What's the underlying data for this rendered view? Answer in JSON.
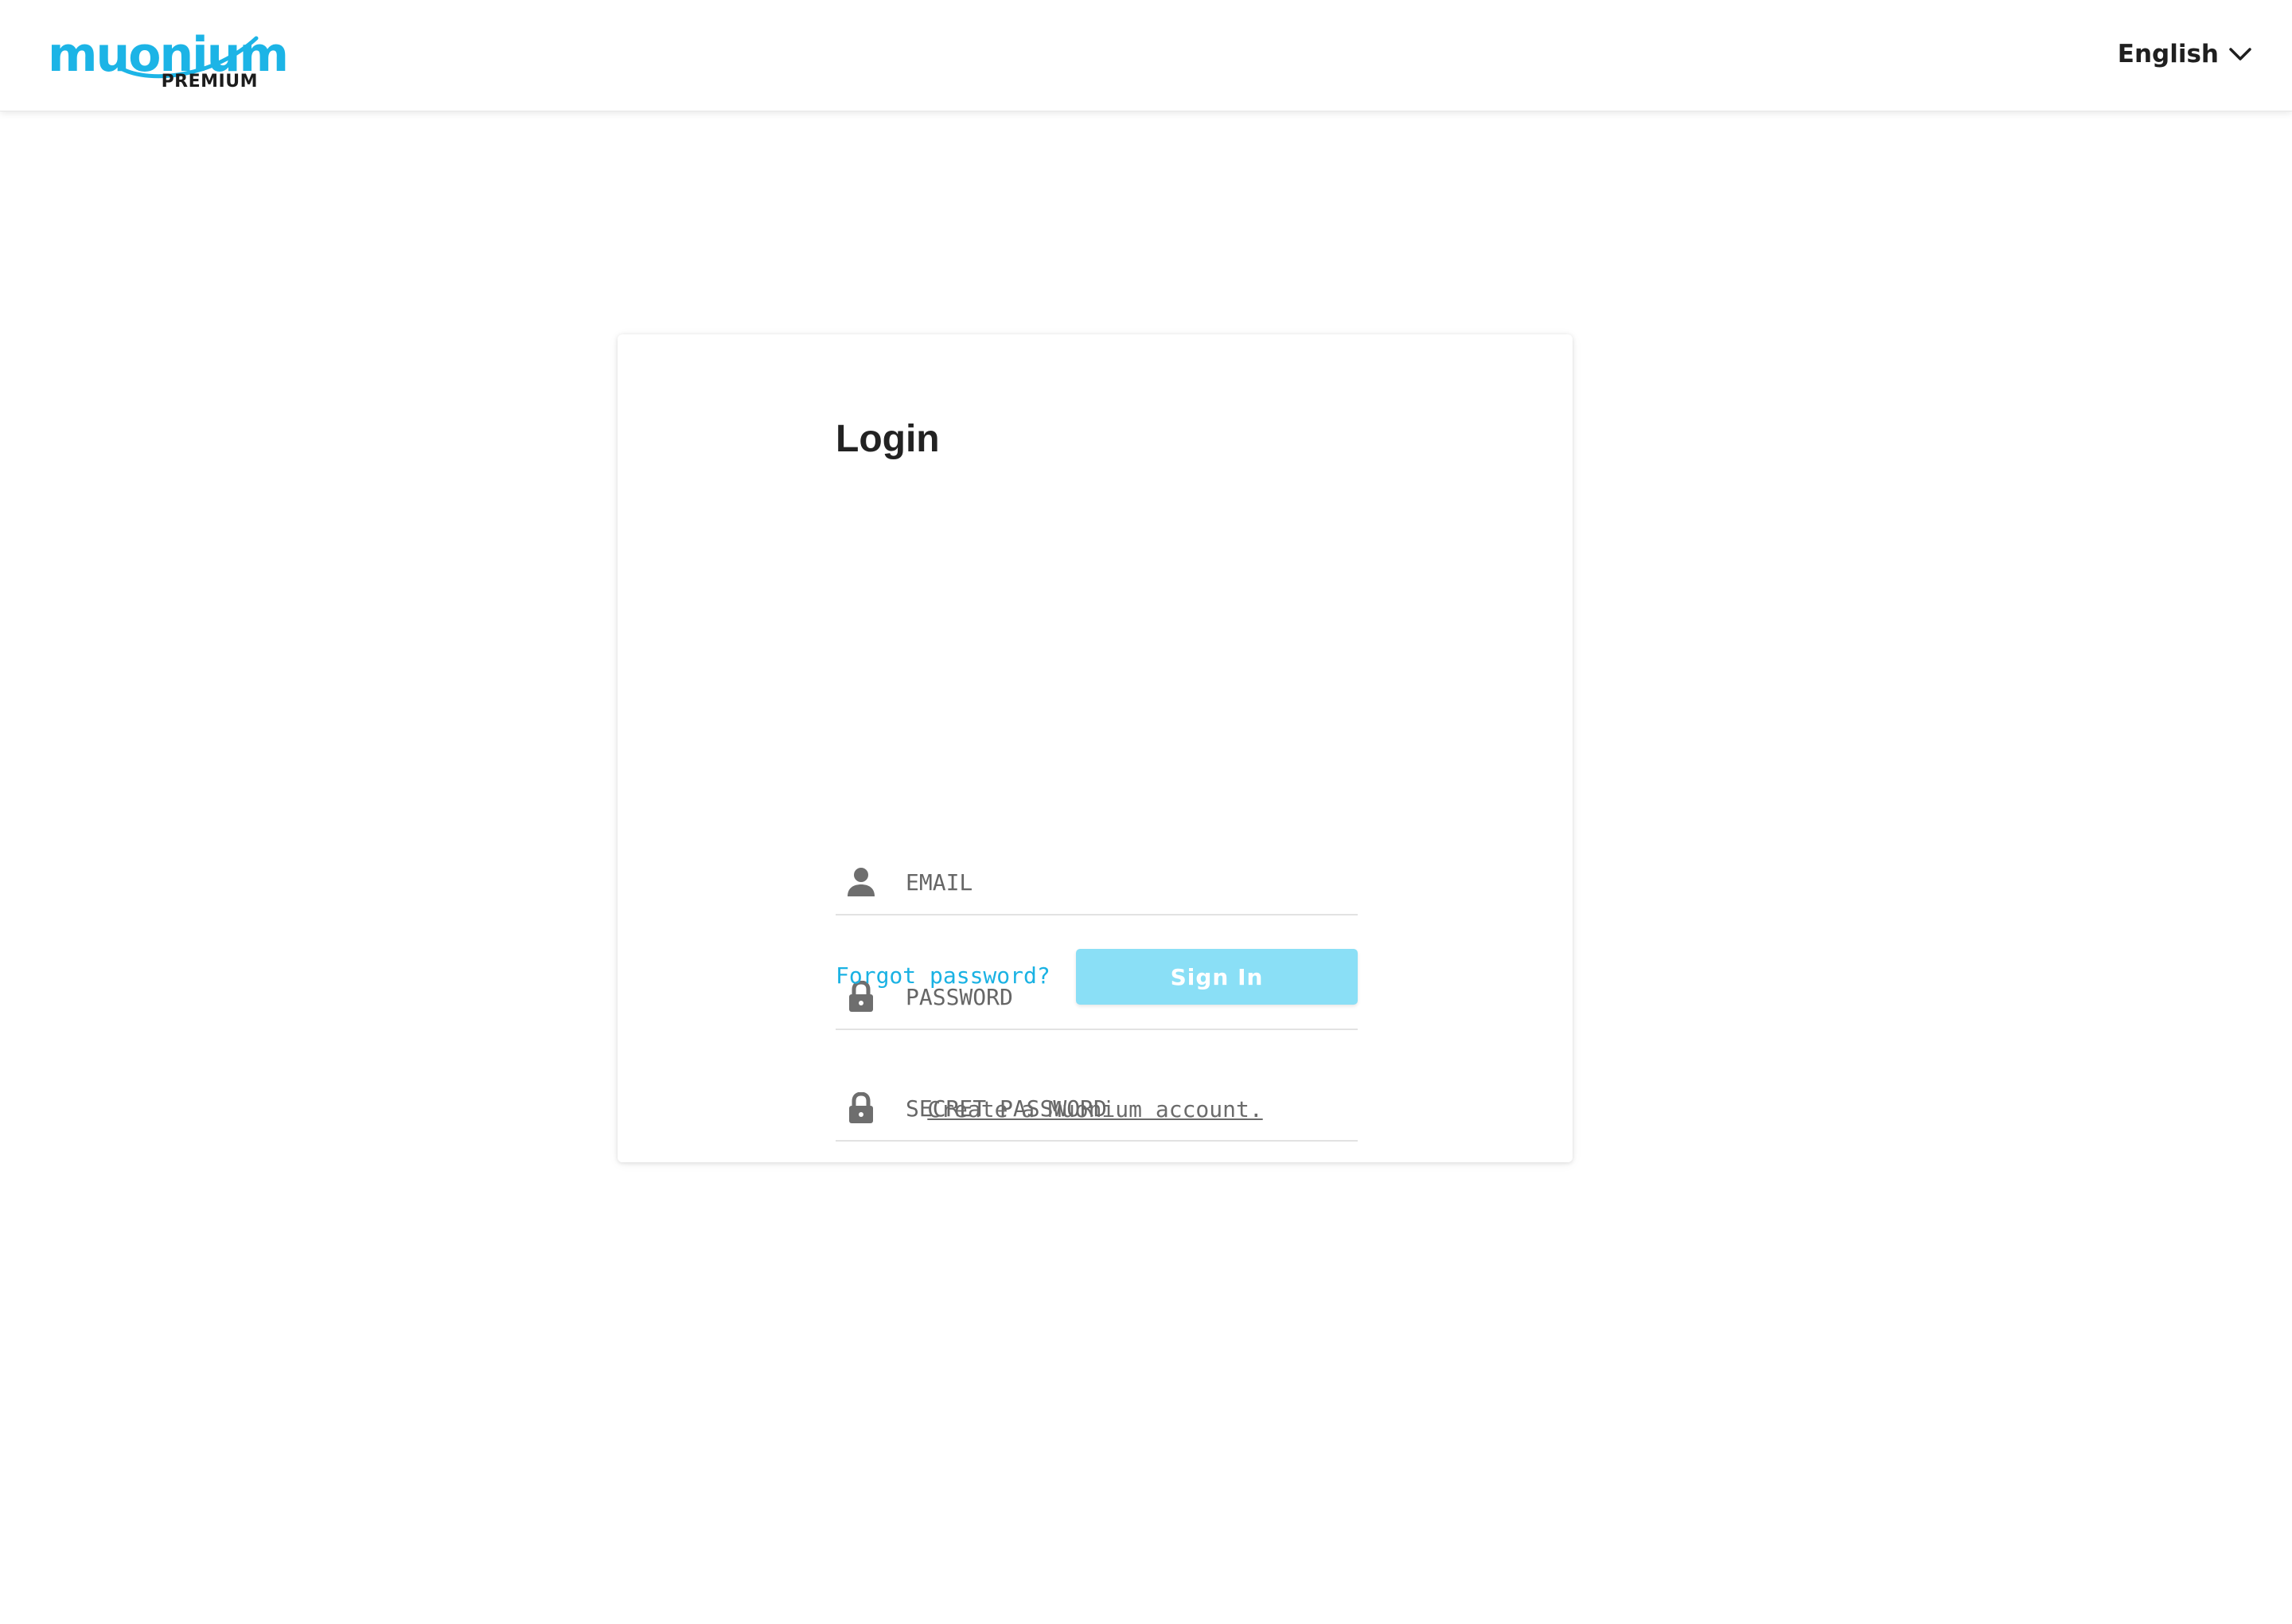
{
  "brand": {
    "name": "muonium",
    "tier": "PREMIUM",
    "color": "#1cb4e6"
  },
  "header": {
    "language": "English",
    "language_icon": "chevron-down-icon"
  },
  "login": {
    "title": "Login",
    "email": {
      "placeholder": "EMAIL",
      "value": "",
      "icon": "user-icon"
    },
    "password": {
      "placeholder": "PASSWORD",
      "value": "",
      "icon": "lock-icon"
    },
    "secret_password": {
      "placeholder": "SECRET PASSWORD",
      "value": "",
      "icon": "lock-icon"
    },
    "forgot_label": "Forgot password?",
    "signin_label": "Sign In",
    "create_account_label": "Create a Muonium account."
  },
  "colors": {
    "accent": "#1ab2e3",
    "button_disabled": "#8adff6",
    "icon": "#6e6e6e"
  }
}
